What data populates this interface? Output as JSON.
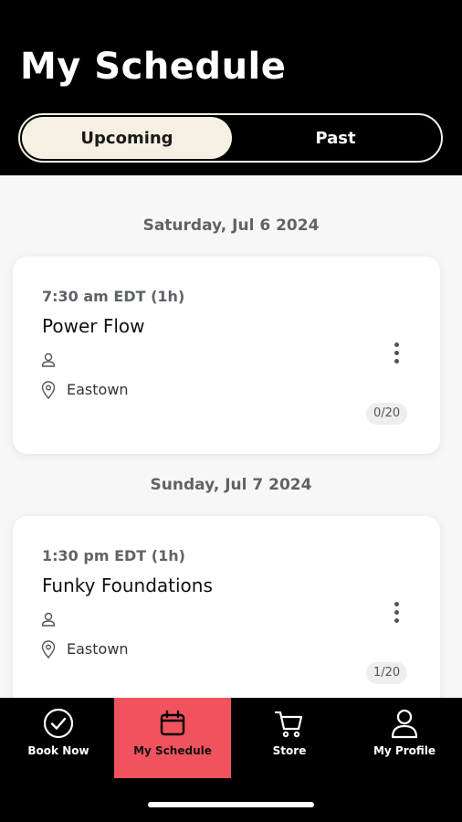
{
  "header": {
    "title": "My Schedule"
  },
  "segments": {
    "upcoming": "Upcoming",
    "past": "Past"
  },
  "groups": [
    {
      "date": "Saturday, Jul 6 2024",
      "class": {
        "time": "7:30 am EDT (1h)",
        "name": "Power Flow",
        "location": "Eastown",
        "capacity": "0/20"
      }
    },
    {
      "date": "Sunday, Jul 7 2024",
      "class": {
        "time": "1:30 pm EDT (1h)",
        "name": "Funky Foundations",
        "location": "Eastown",
        "capacity": "1/20"
      }
    }
  ],
  "tabs": [
    {
      "label": "Book Now",
      "icon": "check-circle-icon"
    },
    {
      "label": "My Schedule",
      "icon": "calendar-icon",
      "active": true
    },
    {
      "label": "Store",
      "icon": "cart-icon"
    },
    {
      "label": "My Profile",
      "icon": "user-icon"
    }
  ],
  "colors": {
    "header_bg": "#000000",
    "segment_active": "#f5efe4",
    "tab_active": "#f0535e"
  }
}
